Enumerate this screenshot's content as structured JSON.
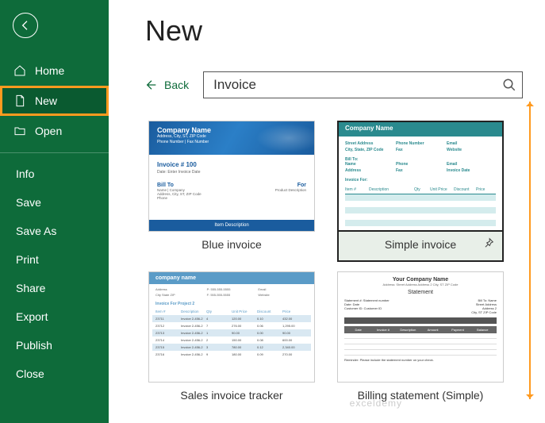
{
  "sidebar": {
    "items": [
      {
        "id": "home",
        "label": "Home"
      },
      {
        "id": "new",
        "label": "New"
      },
      {
        "id": "open",
        "label": "Open"
      }
    ],
    "secondary": [
      {
        "id": "info",
        "label": "Info"
      },
      {
        "id": "save",
        "label": "Save"
      },
      {
        "id": "saveas",
        "label": "Save As"
      },
      {
        "id": "print",
        "label": "Print"
      },
      {
        "id": "share",
        "label": "Share"
      },
      {
        "id": "export",
        "label": "Export"
      },
      {
        "id": "publish",
        "label": "Publish"
      },
      {
        "id": "close",
        "label": "Close"
      }
    ]
  },
  "page": {
    "title": "New",
    "back_label": "Back",
    "search_value": "Invoice"
  },
  "templates": [
    {
      "label": "Blue invoice",
      "selected": false
    },
    {
      "label": "Simple invoice",
      "selected": true
    },
    {
      "label": "Sales invoice tracker",
      "selected": false
    },
    {
      "label": "Billing statement (Simple)",
      "selected": false
    }
  ],
  "thumbs": {
    "blue": {
      "company": "Company Name",
      "addr1": "Address, City, ST, ZIP Code",
      "addr2": "Phone Number | Fax Number",
      "invoice": "Invoice # 100",
      "date": "Date: Enter Invoice Date",
      "billto": "Bill To",
      "billto_lines": "Name | Company\nAddress, City, ST, ZIP Code\nPhone",
      "for": "For",
      "for_lines": "Product Description",
      "footer": "Item Description"
    },
    "simple": {
      "company": "Company Name",
      "labels": [
        "Street Address",
        "Phone Number",
        "Email",
        "City, State, ZIP Code",
        "Fax",
        "Website"
      ],
      "billto": "Bill To:",
      "billto_labels": [
        "Name",
        "Phone",
        "Email",
        "Address",
        "Fax",
        "Invoice Date"
      ],
      "invoice_for": "Invoice For:",
      "cols": [
        "Item #",
        "Description",
        "Qty",
        "Unit Price",
        "Discount",
        "Price"
      ]
    },
    "tracker": {
      "company": "company name",
      "section": "Invoice For Project 2",
      "cols": [
        "Item #",
        "Description",
        "Qty",
        "Unit Price",
        "Discount",
        "Price"
      ]
    },
    "billing": {
      "company": "Your Company Name",
      "addr": "Address: Street Address\nAddress 2\nCity, ST ZIP Code",
      "stmt": "Statement",
      "stmt_no": "Statement #: Statement number",
      "date": "Date: Date",
      "cust": "Customer ID: Customer ID",
      "billto": "Bill To: Name\nStreet Address\nAddress 2\nCity, ST ZIP Code",
      "cols": [
        "Date",
        "Invoice #",
        "Description",
        "Amount",
        "Payment",
        "Balance"
      ],
      "note": "Reminder: Please include the statement number on your check."
    }
  },
  "watermark": "exceldemy"
}
